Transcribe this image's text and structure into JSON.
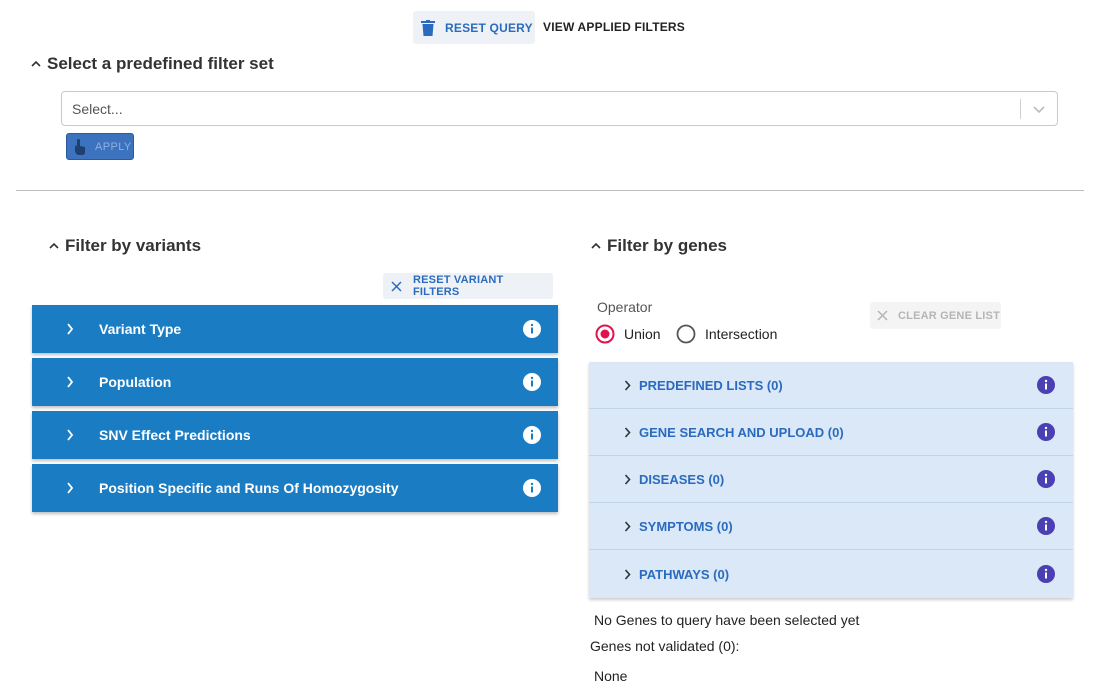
{
  "toolbar": {
    "reset_query_label": "RESET QUERY",
    "view_applied_filters_label": "VIEW APPLIED FILTERS"
  },
  "predefined": {
    "title": "Select a predefined filter set",
    "select_placeholder": "Select...",
    "apply_label": "APPLY"
  },
  "variants": {
    "title": "Filter by variants",
    "reset_label": "RESET VARIANT FILTERS",
    "items": [
      {
        "label": "Variant Type"
      },
      {
        "label": "Population"
      },
      {
        "label": "SNV Effect Predictions"
      },
      {
        "label": "Position Specific and Runs Of Homozygosity"
      }
    ]
  },
  "genes": {
    "title": "Filter by genes",
    "operator_label": "Operator",
    "operator_options": [
      {
        "label": "Union",
        "selected": true
      },
      {
        "label": "Intersection",
        "selected": false
      }
    ],
    "clear_label": "CLEAR GENE LIST",
    "items": [
      {
        "label": "PREDEFINED LISTS (0)"
      },
      {
        "label": "GENE SEARCH AND UPLOAD (0)"
      },
      {
        "label": "DISEASES (0)"
      },
      {
        "label": "SYMPTOMS (0)"
      },
      {
        "label": "PATHWAYS (0)"
      }
    ],
    "no_genes_text": "No Genes to query have been selected yet",
    "not_validated_text": "Genes not validated (0):",
    "none_text": "None"
  },
  "colors": {
    "variant_row_bg": "#1a7dc4",
    "gene_row_bg": "#dae8f7",
    "accent_blue": "#2a6bbf",
    "info_icon": "#4a3fb3",
    "radio_selected": "#e0134f"
  },
  "icons": {
    "reset_query": "trash-icon",
    "apply": "hand-pointer-icon",
    "reset_variants": "close-icon",
    "clear_gene": "close-icon",
    "row_expand": "chevron-right-icon",
    "row_info": "info-icon"
  }
}
